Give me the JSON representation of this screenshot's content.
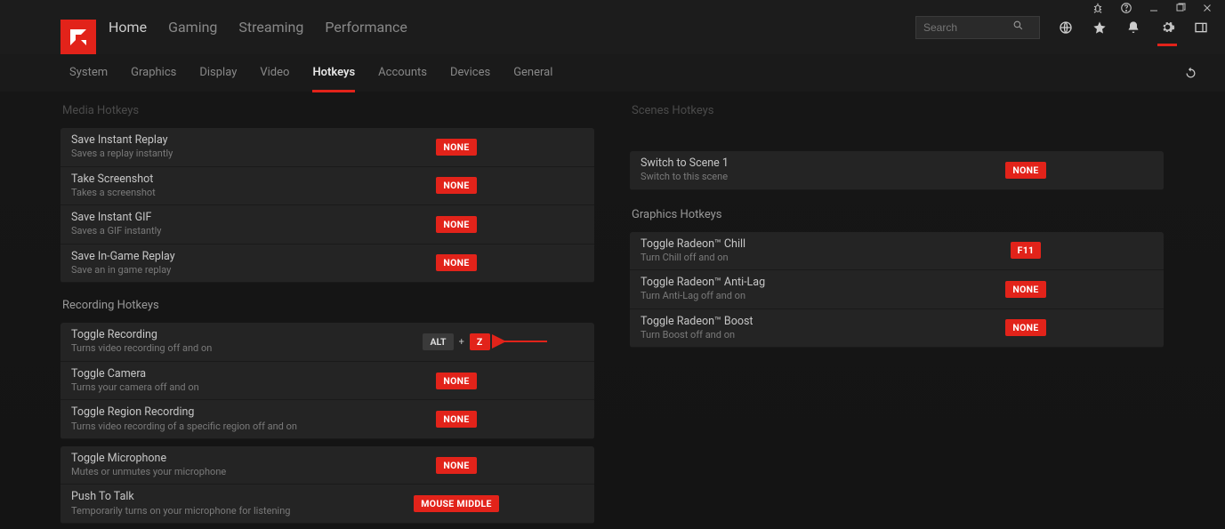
{
  "search": {
    "placeholder": "Search"
  },
  "nav": [
    "Home",
    "Gaming",
    "Streaming",
    "Performance"
  ],
  "tabs": [
    "System",
    "Graphics",
    "Display",
    "Video",
    "Hotkeys",
    "Accounts",
    "Devices",
    "General"
  ],
  "activeTab": "Hotkeys",
  "sections": {
    "media": {
      "title": "Media Hotkeys",
      "items": [
        {
          "title": "Save Instant Replay",
          "desc": "Saves a replay instantly",
          "value": [
            {
              "text": "NONE",
              "type": "badge"
            }
          ]
        },
        {
          "title": "Take Screenshot",
          "desc": "Takes a screenshot",
          "value": [
            {
              "text": "NONE",
              "type": "badge"
            }
          ]
        },
        {
          "title": "Save Instant GIF",
          "desc": "Saves a GIF instantly",
          "value": [
            {
              "text": "NONE",
              "type": "badge"
            }
          ]
        },
        {
          "title": "Save In-Game Replay",
          "desc": "Save an in game replay",
          "value": [
            {
              "text": "NONE",
              "type": "badge"
            }
          ]
        }
      ]
    },
    "recording": {
      "title": "Recording Hotkeys",
      "groupA": [
        {
          "title": "Toggle Recording",
          "desc": "Turns video recording off and on",
          "value": [
            {
              "text": "ALT",
              "type": "key-gray"
            },
            {
              "text": "+",
              "type": "plus"
            },
            {
              "text": "Z",
              "type": "badge"
            }
          ]
        },
        {
          "title": "Toggle Camera",
          "desc": "Turns your camera off and on",
          "value": [
            {
              "text": "NONE",
              "type": "badge"
            }
          ]
        },
        {
          "title": "Toggle Region Recording",
          "desc": "Turns video recording of a specific region off and on",
          "value": [
            {
              "text": "NONE",
              "type": "badge"
            }
          ]
        }
      ],
      "groupB": [
        {
          "title": "Toggle Microphone",
          "desc": "Mutes or unmutes your microphone",
          "value": [
            {
              "text": "NONE",
              "type": "badge"
            }
          ]
        },
        {
          "title": "Push To Talk",
          "desc": "Temporarily turns on your microphone for listening",
          "value": [
            {
              "text": "MOUSE MIDDLE",
              "type": "badge"
            }
          ]
        }
      ]
    },
    "scenes": {
      "title": "Scenes Hotkeys",
      "items": [
        {
          "title": "Switch to Scene 1",
          "desc": "Switch to this scene",
          "value": [
            {
              "text": "NONE",
              "type": "badge"
            }
          ]
        }
      ]
    },
    "graphics": {
      "title": "Graphics Hotkeys",
      "items": [
        {
          "title": "Toggle Radeon™ Chill",
          "desc": "Turn Chill off and on",
          "value": [
            {
              "text": "F11",
              "type": "badge"
            }
          ]
        },
        {
          "title": "Toggle Radeon™ Anti-Lag",
          "desc": "Turn Anti-Lag off and on",
          "value": [
            {
              "text": "NONE",
              "type": "badge"
            }
          ]
        },
        {
          "title": "Toggle Radeon™ Boost",
          "desc": "Turn Boost off and on",
          "value": [
            {
              "text": "NONE",
              "type": "badge"
            }
          ]
        }
      ]
    }
  }
}
